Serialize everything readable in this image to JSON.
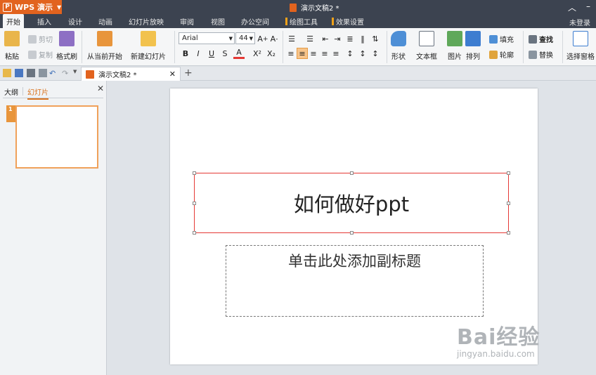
{
  "titlebar": {
    "app_name": "WPS 演示",
    "doc_title": "演示文稿2 *",
    "minimize_glyph": "–",
    "collapse_glyph": "︿"
  },
  "menu": {
    "tabs": [
      "开始",
      "插入",
      "设计",
      "动画",
      "幻灯片放映",
      "审阅",
      "视图",
      "办公空间"
    ],
    "context_tabs": [
      "绘图工具",
      "效果设置"
    ],
    "login": "未登录"
  },
  "ribbon": {
    "paste": "粘贴",
    "cut": "剪切",
    "copy": "复制",
    "format_painter": "格式刷",
    "from_current": "从当前开始",
    "new_slide": "新建幻灯片",
    "font_name": "Arial",
    "font_size": "44",
    "shape": "形状",
    "textbox": "文本框",
    "picture": "图片",
    "arrange": "排列",
    "fill": "填充",
    "outline": "轮廓",
    "find": "查找",
    "replace": "替换",
    "selection_pane": "选择窗格"
  },
  "doc_tab": {
    "name": "演示文稿2 *"
  },
  "left_panel": {
    "tabs": [
      "大纲",
      "幻灯片"
    ],
    "slide_number": "1"
  },
  "slide": {
    "title": "如何做好ppt",
    "subtitle_placeholder": "单击此处添加副标题"
  },
  "watermark": {
    "brand": "Bai经验",
    "url": "jingyan.baidu.com"
  },
  "colors": {
    "accent": "#e2631e",
    "titlebar": "#3c4350",
    "selection": "#e53935"
  }
}
